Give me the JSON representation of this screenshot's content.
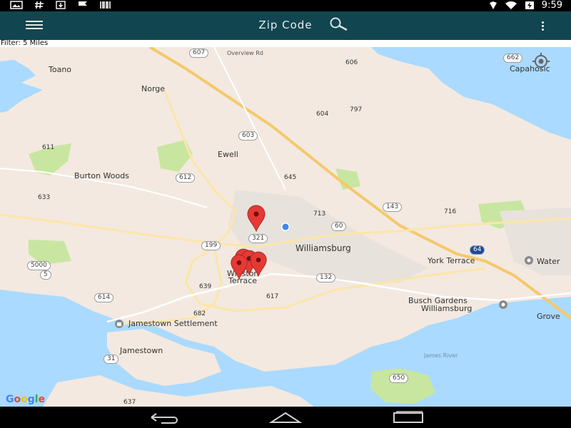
{
  "status_bar": {
    "left_icons": [
      "image-notification-icon",
      "hashtag-icon",
      "download-icon",
      "flag-icon",
      "barcode-icon"
    ],
    "right_icons": [
      "location-icon",
      "wifi-icon",
      "battery-charging-icon"
    ],
    "time": "9:59"
  },
  "app_bar": {
    "title": "Zip Code",
    "menu_icon": "hamburger-menu-icon",
    "search_icon": "search-icon",
    "overflow_icon": "more-vert-icon",
    "background": "#114650"
  },
  "filter": {
    "text": "Filter: 5 Miles"
  },
  "map": {
    "attribution": "Google",
    "places": {
      "toano": "Toano",
      "norge": "Norge",
      "ewell": "Ewell",
      "burton_woods": "Burton Woods",
      "williamsburg": "Williamsburg",
      "winston": "Winston",
      "terrace": "Terrace",
      "york_terrace": "York Terrace",
      "busch_1": "Busch Gardens",
      "busch_2": "Williamsburg",
      "jamestown_settlement": "Jamestown Settlement",
      "jamestown": "Jamestown",
      "capahosic": "Capahosic",
      "water": "Water",
      "grove": "Grove",
      "overview_rd": "Overview Rd",
      "jones_river": "James River"
    },
    "routes": {
      "r607": "607",
      "r606": "606",
      "r604": "604",
      "r797": "797",
      "r603": "603",
      "r611": "611",
      "r612": "612",
      "r645": "645",
      "r633": "633",
      "r713": "713",
      "r143": "143",
      "r716": "716",
      "r60": "60",
      "r321": "321",
      "r199": "199",
      "r64": "64",
      "r5000": "5000",
      "r5": "5",
      "r614": "614",
      "r639": "639",
      "r617": "617",
      "r132": "132",
      "r682": "682",
      "r31": "31",
      "r637": "637",
      "r650": "650",
      "r662": "662"
    },
    "marker_color": "#e53935",
    "my_location_dot_color": "#4285f4",
    "water_color": "#aadaff",
    "land_color": "#f3e9e0",
    "park_color": "#c8e6a0"
  },
  "nav_bar": {
    "back_icon": "back-icon",
    "home_icon": "home-icon",
    "recents_icon": "recents-icon"
  }
}
